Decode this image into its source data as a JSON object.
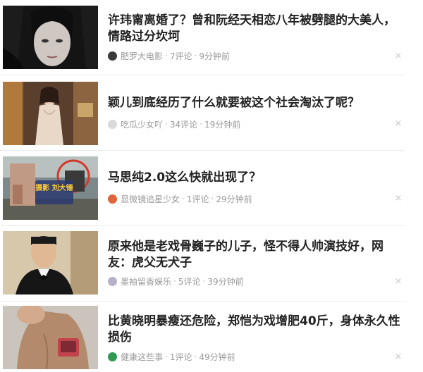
{
  "feed": {
    "items": [
      {
        "title": "许玮甯离婚了？曾和阮经天相恋八年被劈腿的大美人，情路过分坎坷",
        "source": "肥罗大电影",
        "comments": "7评论",
        "time": "9分钟前",
        "close_glyph": "×",
        "avatar_icon": "film-avatar-icon",
        "avatar_color": "#3a3a3a"
      },
      {
        "title": "颖儿到底经历了什么就要被这个社会淘汰了呢？",
        "source": "吃瓜少女吖",
        "comments": "34评论",
        "time": "19分钟前",
        "close_glyph": "×",
        "avatar_icon": "girl-avatar-icon",
        "avatar_color": "#d9d9d9"
      },
      {
        "title": "马思纯2.0这么快就出现了？",
        "source": "显微镜追星少女",
        "comments": "1评论",
        "time": "29分钟前",
        "close_glyph": "×",
        "avatar_icon": "star-girl-avatar-icon",
        "avatar_color": "#e0643c",
        "thumb_text": "摄影 刘大锤"
      },
      {
        "title": "原来他是老戏骨巍子的儿子，怪不得人帅演技好，网友：虎父无犬子",
        "source": "墨袖留香娱乐",
        "comments": "5评论",
        "time": "39分钟前",
        "close_glyph": "×",
        "avatar_icon": "ink-avatar-icon",
        "avatar_color": "#b7b0c9"
      },
      {
        "title": "比黄晓明暴瘦还危险，郑恺为戏增肥40斤，身体永久性损伤",
        "source": "健康这些事",
        "comments": "1评论",
        "time": "49分钟前",
        "close_glyph": "×",
        "avatar_icon": "health-avatar-icon",
        "avatar_color": "#2f9a54"
      }
    ]
  }
}
